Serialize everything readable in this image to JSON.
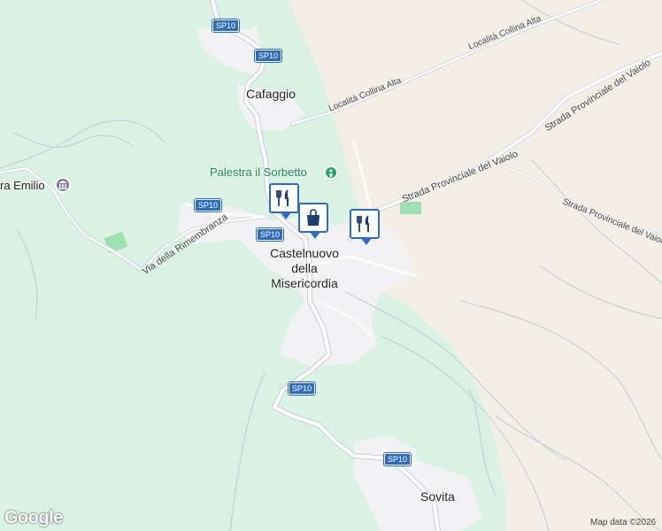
{
  "map": {
    "colors": {
      "forest": "#d9f2e4",
      "farmland": "#f4efe6",
      "urban": "#f2f2f4",
      "road": "#ffffff",
      "road_outline": "#c8ccd6",
      "shield": "#2e6cc2",
      "park": "#9ee0b0"
    },
    "places": {
      "cafaggio": "Cafaggio",
      "castelnuovo": "Castelnuovo\ndella\nMisericordia",
      "sovita": "Sovita",
      "emilio": "ra Emilio"
    },
    "roads": {
      "collina_alta_1": "Località Collina Alta",
      "collina_alta_2": "Località Collina Alta",
      "vaiolo_1": "Strada Provinciale del Vaiolo",
      "vaiolo_2": "Strada Provinciale del Vaiolo",
      "vaiolo_3": "Strada Provinciale del Vaiolo",
      "rimembranza": "Via della Rimembranza"
    },
    "shields": [
      "SP10",
      "SP10",
      "SP10",
      "SP10",
      "SP10",
      "SP10"
    ],
    "pois": {
      "palestra": "Palestra il Sorbetto"
    },
    "icons": [
      "restaurant-icon",
      "shopping-bag-icon",
      "restaurant-icon",
      "fitness-icon",
      "museum-icon"
    ]
  },
  "footer": {
    "logo": "Google",
    "credit": "Map data ©2026"
  }
}
